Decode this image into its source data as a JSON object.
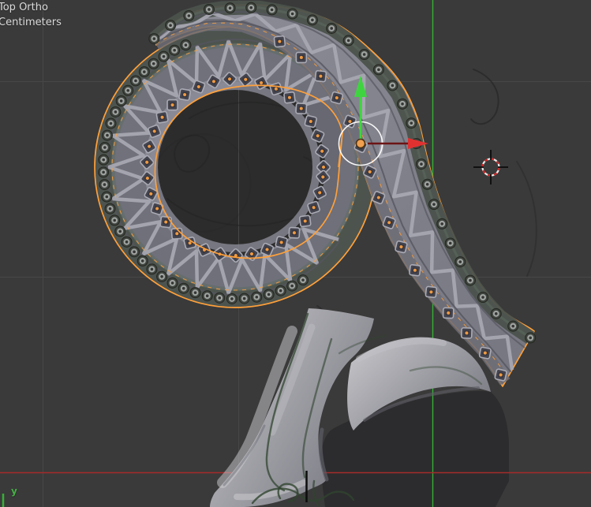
{
  "viewport": {
    "view_label": "Top Ortho",
    "unit_label": "Centimeters",
    "mini_axis_label": "y"
  },
  "colors": {
    "background": "#3a3a3a",
    "hole_shadow": "#2c2c2c",
    "under_shadow": "#2b2b2e",
    "grid_line": "#474747",
    "axis_y_green": "#35b135",
    "axis_x_red": "#a62a2a",
    "selection_outline": "#ffa03a",
    "band_base_light": "#90909a",
    "band_base_dark": "#73737d",
    "lattice_band": "#6e6f79",
    "strut_light": "#a6a7b1",
    "rail_dark": "#55555f",
    "knob_band": "#4b524c",
    "knob_dark": "#40443f",
    "knob_light": "#9fa3a0",
    "jewel_frame": "#aaabb5",
    "jewel_fill": "#44444e",
    "jewel_orange": "#f09a40",
    "green_tint": "#5d6b5f",
    "neck_light": "#c9c9cd",
    "neck_dark": "#7b7b84",
    "neck_edge_dark": "#5d5d66",
    "sketch_dark": "#1f211f",
    "sketch_green": "#31452f",
    "gizmo_green": "#3fd43f",
    "gizmo_red": "#e03131",
    "gizmo_red_line": "#6b1414",
    "gizmo_center": "#f0a050",
    "gizmo_circle": "#ffffff",
    "cursor_red": "#cc2222",
    "cursor_white": "#e8e8e8",
    "cursor_cross": "#0c0c0c",
    "origin_line": "#0d0d0d",
    "text": "#dcdcdc"
  }
}
